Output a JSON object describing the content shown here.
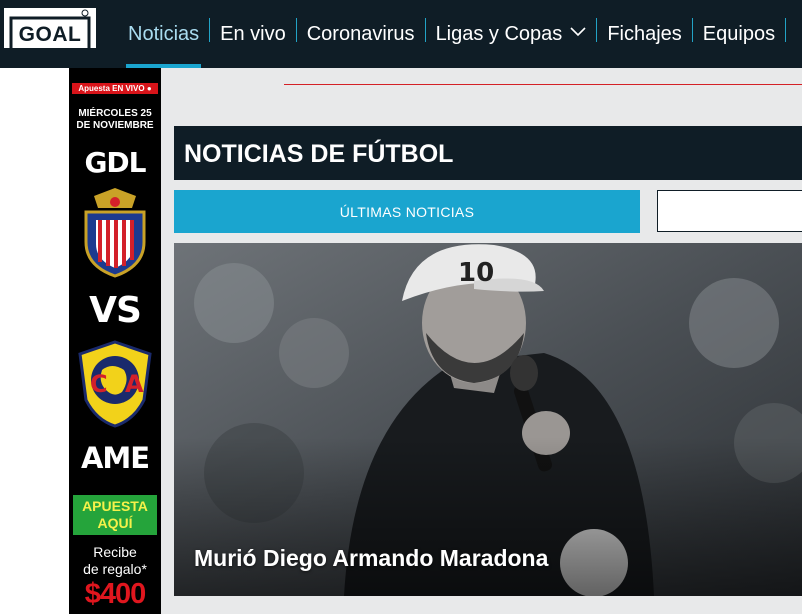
{
  "brand": {
    "logo_text": "GOAL"
  },
  "nav": {
    "items": [
      {
        "label": "Noticias",
        "active": true
      },
      {
        "label": "En vivo"
      },
      {
        "label": "Coronavirus"
      },
      {
        "label": "Ligas y Copas",
        "has_dropdown": true
      },
      {
        "label": "Fichajes"
      },
      {
        "label": "Equipos"
      }
    ]
  },
  "ad": {
    "live_label": "Apuesta EN VIVO",
    "date_line1": "MIÉRCOLES 25",
    "date_line2": "DE NOVIEMBRE",
    "home_team": "GDL",
    "versus": "VS",
    "away_team": "AME",
    "cta_line1": "APUESTA",
    "cta_line2": "AQUÍ",
    "promo_line1": "Recibe",
    "promo_line2": "de regalo*",
    "promo_amount": "$400"
  },
  "section": {
    "title": "NOTICIAS DE FÚTBOL",
    "tabs": [
      {
        "label": "ÚLTIMAS NOTICIAS",
        "active": true
      },
      {
        "label": ""
      }
    ]
  },
  "hero": {
    "headline": "Murió Diego Armando Maradona",
    "cap_number": "10"
  },
  "colors": {
    "nav_bg": "#0f1d26",
    "accent": "#1aa5cf",
    "page_bg": "#e8e9ea",
    "ad_red": "#e0161e",
    "ad_green": "#25a43b"
  }
}
